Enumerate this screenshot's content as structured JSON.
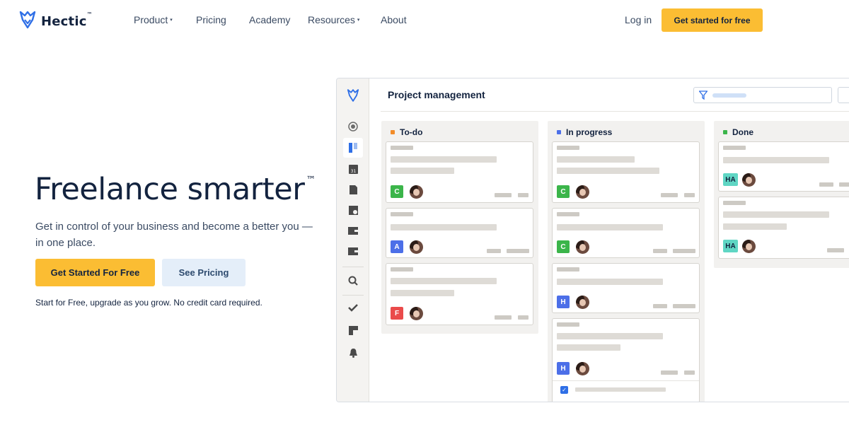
{
  "nav": {
    "brand": "Hectic",
    "brand_tm": "™",
    "items": [
      {
        "label": "Product",
        "has_caret": true
      },
      {
        "label": "Pricing",
        "has_caret": false
      },
      {
        "label": "Academy",
        "has_caret": false
      },
      {
        "label": "Resources",
        "has_caret": true
      },
      {
        "label": "About",
        "has_caret": false
      }
    ],
    "caret": "▾",
    "login": "Log in",
    "cta": "Get started for free"
  },
  "hero": {
    "title": "Freelance smarter",
    "title_tm": "™",
    "subtitle": "Get in control of your business and become a better you — in one place.",
    "primary_button": "Get Started For Free",
    "secondary_button": "See Pricing",
    "note": "Start for Free, upgrade as you grow. No credit card required."
  },
  "app": {
    "title": "Project management",
    "sidebar_icons": [
      "logo-icon",
      "profile-icon",
      "projects-icon",
      "calendar-icon",
      "invoice-icon",
      "proposal-icon",
      "wallet-icon",
      "wallet-icon",
      "search-icon",
      "check-icon",
      "layout-icon",
      "bell-icon"
    ],
    "calendar_day": "31",
    "columns": [
      {
        "name": "To-do",
        "color": "#f28c28",
        "cards": [
          {
            "tag": "C",
            "tag_color": "#3bb54a"
          },
          {
            "tag": "A",
            "tag_color": "#4c6fe8"
          },
          {
            "tag": "F",
            "tag_color": "#ea4b4b"
          }
        ]
      },
      {
        "name": "In progress",
        "color": "#4c6fe8",
        "cards": [
          {
            "tag": "C",
            "tag_color": "#3bb54a"
          },
          {
            "tag": "C",
            "tag_color": "#3bb54a"
          },
          {
            "tag": "H",
            "tag_color": "#4c6fe8"
          },
          {
            "tag": "H",
            "tag_color": "#4c6fe8"
          }
        ]
      },
      {
        "name": "Done",
        "color": "#3bb54a",
        "cards": [
          {
            "tag": "HA",
            "tag_color": "#5fd6c4"
          },
          {
            "tag": "HA",
            "tag_color": "#5fd6c4"
          }
        ]
      }
    ]
  },
  "colors": {
    "accent": "#fbbd33",
    "navy": "#13233f",
    "secondary_bg": "#e4eef9"
  }
}
